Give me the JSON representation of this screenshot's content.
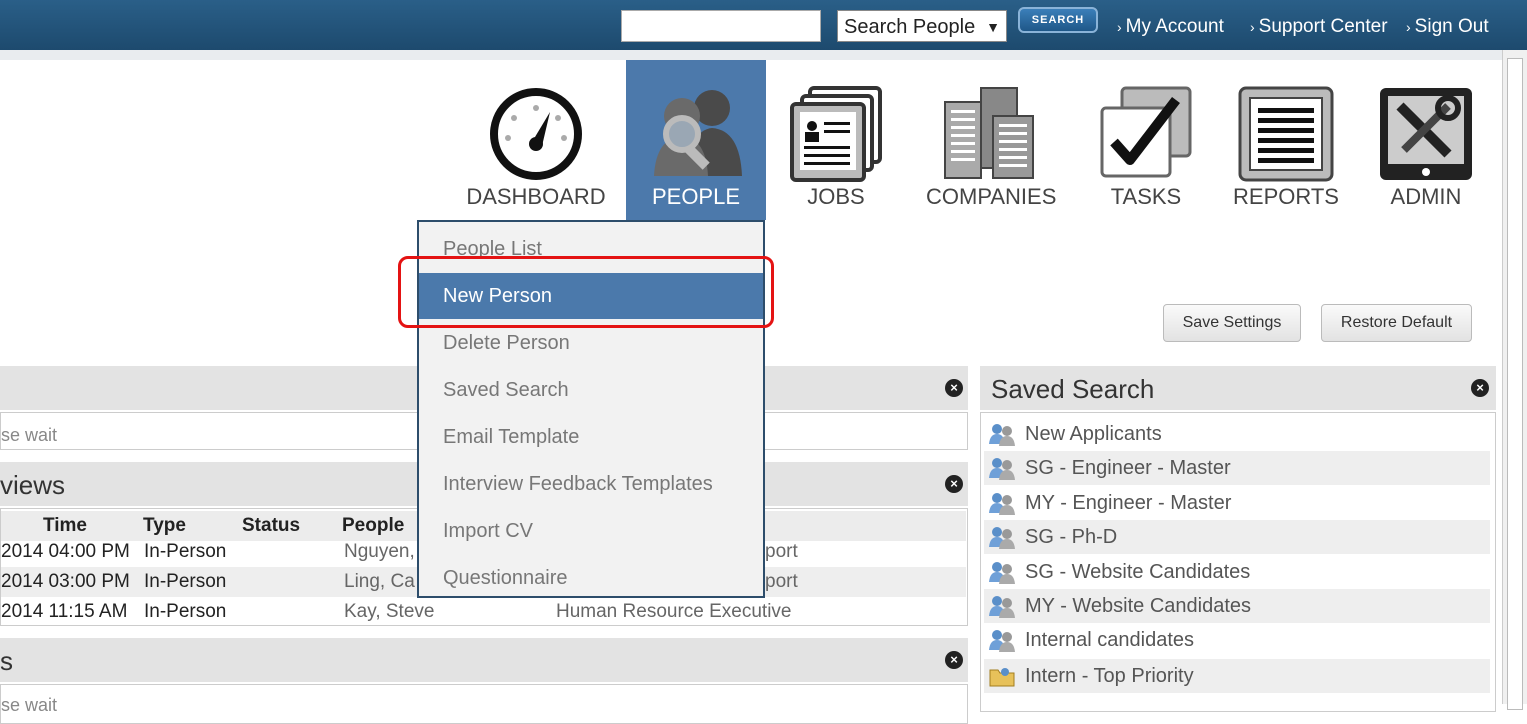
{
  "topbar": {
    "search_select": "Search People",
    "search_button": "SEARCH",
    "links": [
      "My Account",
      "Support Center",
      "Sign Out"
    ]
  },
  "nav": [
    {
      "label": "DASHBOARD",
      "icon": "dashboard-gauge-icon"
    },
    {
      "label": "PEOPLE",
      "icon": "people-search-icon",
      "active": true
    },
    {
      "label": "JOBS",
      "icon": "jobs-cards-icon"
    },
    {
      "label": "COMPANIES",
      "icon": "companies-buildings-icon"
    },
    {
      "label": "TASKS",
      "icon": "tasks-checkbox-icon"
    },
    {
      "label": "REPORTS",
      "icon": "reports-document-icon"
    },
    {
      "label": "ADMIN",
      "icon": "admin-tools-icon"
    }
  ],
  "dropdown": {
    "items": [
      "People List",
      "New Person",
      "Delete Person",
      "Saved Search",
      "Email Template",
      "Interview Feedback Templates",
      "Import CV",
      "Questionnaire"
    ],
    "selected": "New Person",
    "highlight_color": "#e41313"
  },
  "buttons": {
    "save": "Save Settings",
    "restore": "Restore Default"
  },
  "left_panel_1": {
    "wait": "se wait"
  },
  "interviews": {
    "title": "views",
    "columns": [
      "Time",
      "Type",
      "Status",
      "People"
    ],
    "rows": [
      {
        "time": "2014 04:00 PM",
        "type": "In-Person",
        "status": "",
        "people": "Nguyen,",
        "extra": "port"
      },
      {
        "time": "2014 03:00 PM",
        "type": "In-Person",
        "status": "",
        "people": "Ling, Ca",
        "extra": "port"
      },
      {
        "time": "2014 11:15 AM",
        "type": "In-Person",
        "status": "",
        "people": "Kay, Steve",
        "extra": "Human Resource Executive"
      }
    ]
  },
  "left_panel_3": {
    "title": "s",
    "wait": "se wait"
  },
  "saved_search": {
    "title": "Saved Search",
    "items": [
      {
        "label": "New Applicants",
        "icon": "people-group-icon"
      },
      {
        "label": "SG - Engineer - Master",
        "icon": "people-group-icon"
      },
      {
        "label": "MY - Engineer - Master",
        "icon": "people-group-icon"
      },
      {
        "label": "SG - Ph-D",
        "icon": "people-group-icon"
      },
      {
        "label": "SG - Website Candidates",
        "icon": "people-group-icon"
      },
      {
        "label": "MY - Website Candidates",
        "icon": "people-group-icon"
      },
      {
        "label": "Internal candidates",
        "icon": "people-group-icon"
      },
      {
        "label": "Intern - Top Priority",
        "icon": "folder-people-icon"
      }
    ]
  },
  "colors": {
    "topbar": "#1d4a6e",
    "nav_active": "#4c79ab",
    "dropdown_selected": "#4b79ab"
  }
}
